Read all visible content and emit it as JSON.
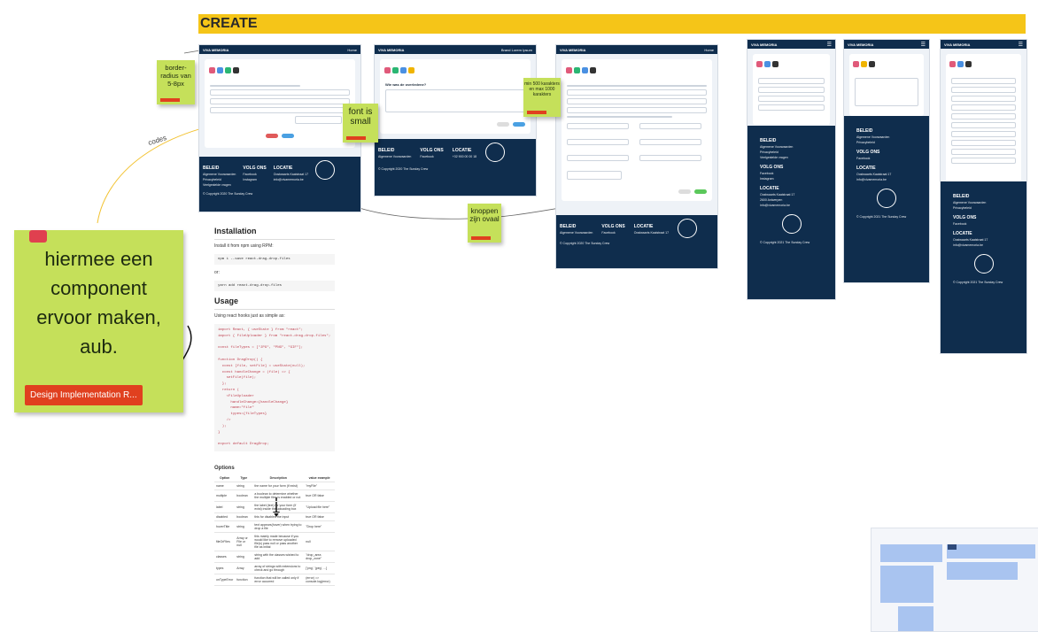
{
  "board": {
    "title": "CREATE",
    "colors": {
      "accent": "#f5c518",
      "navy": "#0f2d4d",
      "sticky": "#c5e05a",
      "tag": "#e0401f"
    }
  },
  "mockups": {
    "brand": "VIVA MEMORIA",
    "nav_home": "Home",
    "nav_user": "Brand Lorem Ipsum",
    "footer": {
      "col1_title": "BELEID",
      "col1_items": [
        "Algemene Voorwaarden",
        "Privacybeleid",
        "Veelgestelde vragen"
      ],
      "col2_title": "VOLG ONS",
      "col2_items": [
        "Facebook",
        "Instagram"
      ],
      "col3_title": "LOCATIE",
      "col3_items": [
        "Oostwaarts Kaaistraat 17",
        "2600 Antwerpen",
        "+32 900 00 00 18",
        "info@vivamemoria.be"
      ],
      "copyright": "© Copyright 2020 The Sunday Crew",
      "copyright_mobile": "© Copyright 2021 The Sunday Crew"
    },
    "question": "Wie was de overledene?",
    "button_cancel": "Vorige",
    "button_next": "Volgende"
  },
  "notes": {
    "border_radius": "border-radius van 5-8px",
    "font_small": "font is small",
    "chars": "min 500 karakters en max 1000 karakters",
    "buttons_oval": "knoppen zijn ovaal",
    "component_request": "hiermee een component ervoor maken, aub.",
    "component_tag": "Design Implementation R...",
    "connector_label": "codes"
  },
  "docs": {
    "install_title": "Installation",
    "install_text": "Install it from npm using RPM:",
    "install_cmd": "npm i --save react-drag-drop-files",
    "or_text": "or:",
    "yarn_cmd": "yarn add react-drag-drop-files",
    "usage_title": "Usage",
    "usage_text": "Using react hooks just as simple as:",
    "code": [
      "import React, { useState } from \"react\";",
      "import { FileUploader } from \"react-drag-drop-files\";",
      "",
      "const fileTypes = [\"JPG\", \"PNG\", \"GIF\"];",
      "",
      "function DragDrop() {",
      "  const [file, setFile] = useState(null);",
      "  const handleChange = (file) => {",
      "    setFile(file);",
      "  };",
      "  return (",
      "    <FileUploader",
      "      handleChange={handleChange}",
      "      name=\"file\"",
      "      types={fileTypes}",
      "    />",
      "  );",
      "}",
      "",
      "export default DragDrop;"
    ],
    "options_title": "Options",
    "options_headers": [
      "Option",
      "Type",
      "Description",
      "value example"
    ],
    "options_rows": [
      [
        "name",
        "string",
        "the name for your form (if exist)",
        "\"myFile\""
      ],
      [
        "multiple",
        "boolean",
        "a boolean to determine whether the multiple files is enabled or not",
        "true OR false"
      ],
      [
        "label",
        "string",
        "the label (text) for your form (if exist) inside the uploading box",
        "\"Upload file here\""
      ],
      [
        "disabled",
        "boolean",
        "this for disabled the input",
        "true OR false"
      ],
      [
        "hoverTitle",
        "string",
        "text appears(hover) when trying to drop a file",
        "\"Drop here\""
      ],
      [
        "fileOrFiles",
        "Array or File or null",
        "this mainly made because if you would like to remove uploaded file(s) pass null or pass another file as initial",
        "null"
      ],
      [
        "classes",
        "string",
        "string with the classes wished to add",
        "\"drop_area drop_zone\""
      ],
      [
        "types",
        "Array",
        "array of strings with extensions to check and go through",
        "['png', 'jpeg', ...]"
      ],
      [
        "onTypeError",
        "function",
        "function that will be called only if error occurred",
        "(error) => console.log(error)"
      ]
    ]
  }
}
